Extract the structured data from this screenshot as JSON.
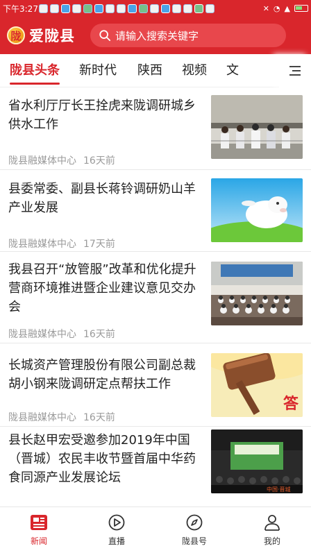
{
  "status_bar": {
    "time": "下午3:27"
  },
  "app": {
    "title": "爱陇县",
    "logo_char": "陇"
  },
  "search": {
    "placeholder": "请输入搜索关键字"
  },
  "tabs": [
    {
      "label": "陇县头条",
      "active": true
    },
    {
      "label": "新时代"
    },
    {
      "label": "陕西"
    },
    {
      "label": "视频"
    },
    {
      "label": "文"
    }
  ],
  "news": [
    {
      "title": "省水利厅厅长王拴虎来陇调研城乡供水工作",
      "source": "陇县融媒体中心",
      "time": "16天前"
    },
    {
      "title": "县委常委、副县长蒋铃调研奶山羊产业发展",
      "source": "陇县融媒体中心",
      "time": "17天前"
    },
    {
      "title": "我县召开“放管服”改革和优化提升营商环境推进暨企业建议意见交办会",
      "source": "陇县融媒体中心",
      "time": "16天前"
    },
    {
      "title": "长城资产管理股份有限公司副总裁胡小钢来陇调研定点帮扶工作",
      "source": "陇县融媒体中心",
      "time": "16天前"
    },
    {
      "title": "县长赵甲宏受邀参加2019年中国（晋城）农民丰收节暨首届中华药食同源产业发展论坛",
      "source": "",
      "time": ""
    }
  ],
  "thumb_text": {
    "item4": "答",
    "item5": "中国·晋城"
  },
  "bottom_nav": [
    {
      "label": "新闻",
      "icon": "news-icon",
      "active": true
    },
    {
      "label": "直播",
      "icon": "live-icon"
    },
    {
      "label": "陇县号",
      "icon": "compass-icon"
    },
    {
      "label": "我的",
      "icon": "person-icon"
    }
  ],
  "colors": {
    "brand": "#d9262c",
    "meta": "#9a9a9a"
  }
}
